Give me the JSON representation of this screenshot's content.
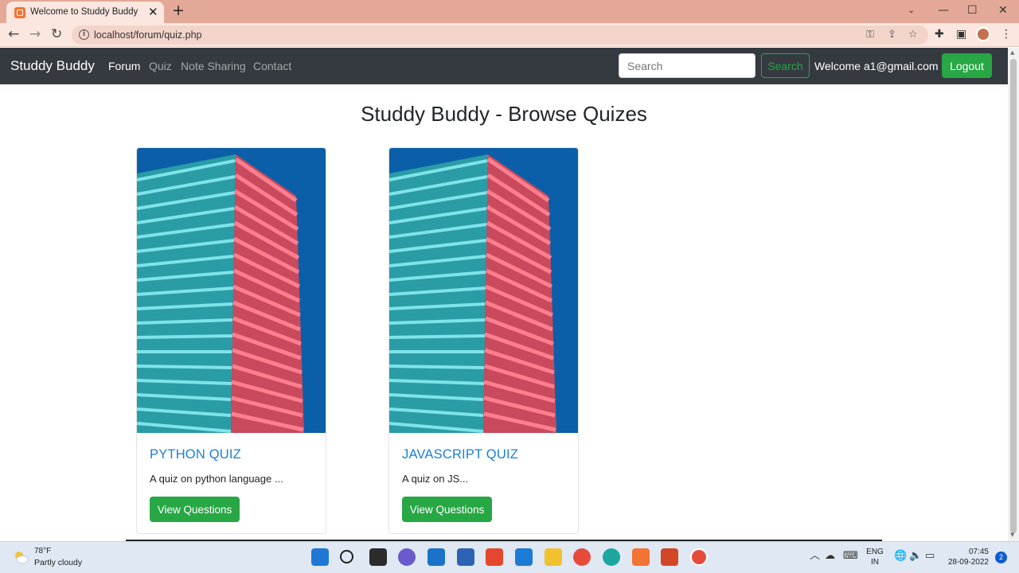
{
  "browser": {
    "tab_title": "Welcome to Studdy Buddy",
    "tab_close": "✕",
    "new_tab": "+",
    "url": "localhost/forum/quiz.php",
    "window_controls": {
      "minimize": "—",
      "maximize": "☐",
      "close": "✕"
    },
    "icons": [
      "back-arrow-icon",
      "forward-arrow-icon",
      "reload-icon",
      "key-icon",
      "share-icon",
      "star-icon",
      "extensions-icon",
      "sidepanel-icon",
      "menu-icon"
    ]
  },
  "navbar": {
    "brand": "Studdy Buddy",
    "links": [
      {
        "label": "Forum",
        "active": true
      },
      {
        "label": "Quiz",
        "active": false
      },
      {
        "label": "Note Sharing",
        "active": false
      },
      {
        "label": "Contact",
        "active": false
      }
    ],
    "search_placeholder": "Search",
    "search_button": "Search",
    "welcome": "Welcome a1@gmail.com",
    "logout": "Logout"
  },
  "main": {
    "title": "Studdy Buddy - Browse Quizes",
    "cards": [
      {
        "title": "PYTHON QUIZ",
        "text": "A quiz on python language ...",
        "button": "View Questions"
      },
      {
        "title": "JAVASCRIPT QUIZ",
        "text": "A quiz on JS...",
        "button": "View Questions"
      }
    ]
  },
  "taskbar": {
    "weather_temp": "78°F",
    "weather_desc": "Partly cloudy",
    "lang_top": "ENG",
    "lang_bottom": "IN",
    "time": "07:45",
    "date": "28-09-2022",
    "notifications": "2"
  },
  "colors": {
    "navbar_bg": "#343a40",
    "accent_green": "#28a745",
    "link_blue": "#1a7fd8",
    "tab_strip": "#e3a897"
  }
}
